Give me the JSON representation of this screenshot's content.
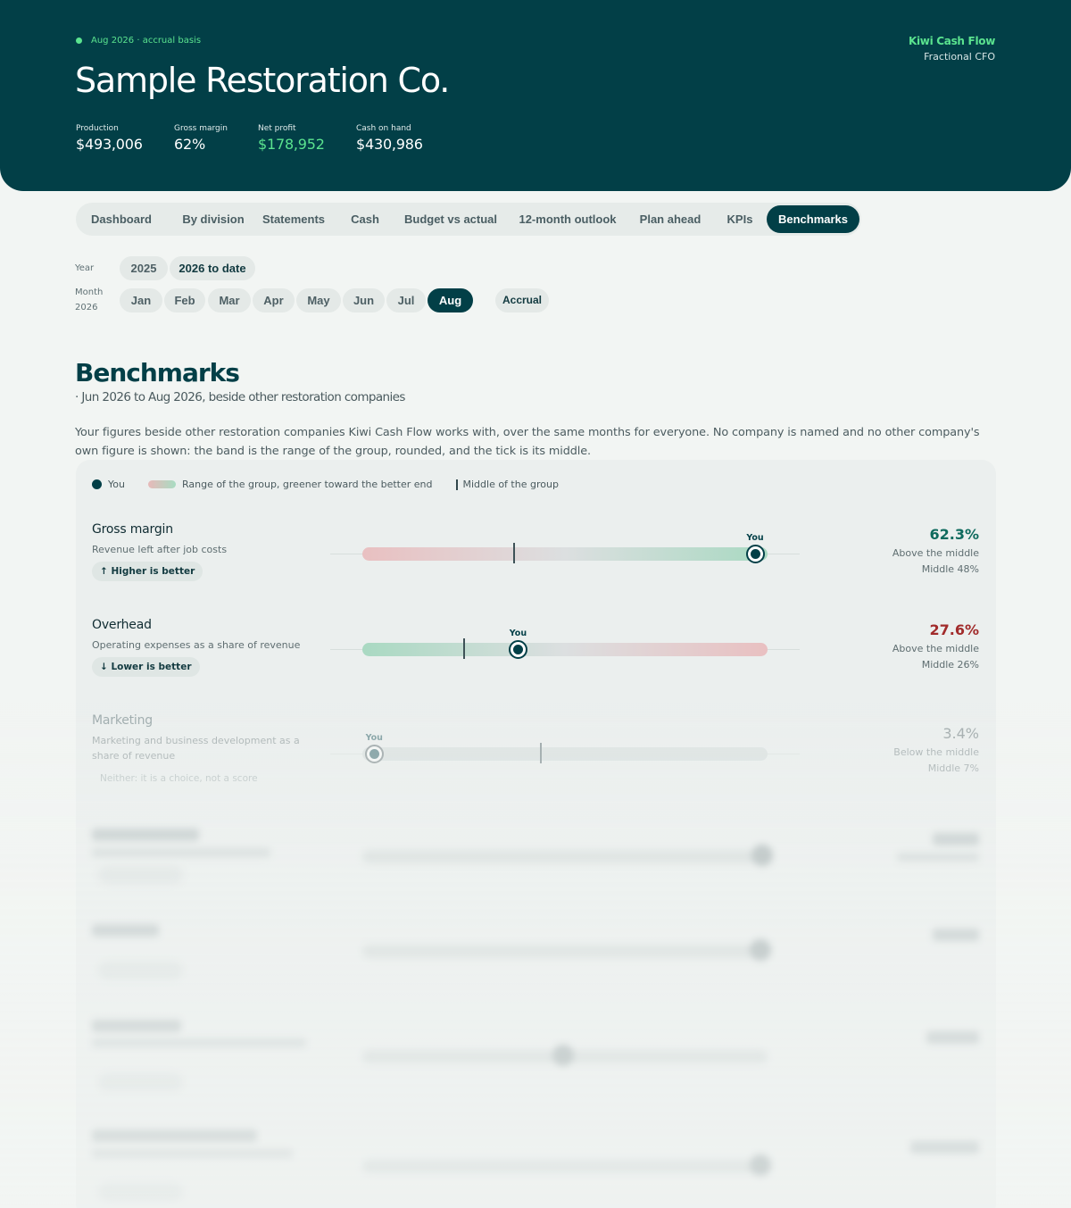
{
  "header": {
    "period": "Aug 2026 · accrual basis",
    "company": "Sample Restoration Co.",
    "brand": "Kiwi Cash Flow",
    "brand_role": "Fractional CFO",
    "stats": [
      {
        "label": "Production",
        "value": "$493,006"
      },
      {
        "label": "Gross margin",
        "value": "62%"
      },
      {
        "label": "Net profit",
        "value": "$178,952"
      },
      {
        "label": "Cash on hand",
        "value": "$430,986"
      }
    ]
  },
  "tabs": [
    "Dashboard",
    "By division",
    "Statements",
    "Cash",
    "Budget vs actual",
    "12-month outlook",
    "Plan ahead",
    "KPIs",
    "Benchmarks"
  ],
  "active_tab": "Benchmarks",
  "filters": {
    "year_label": "Year",
    "years": [
      "2025",
      "2026 to date"
    ],
    "month_label": "Month",
    "month_year": "2026",
    "months": [
      "Jan",
      "Feb",
      "Mar",
      "Apr",
      "May",
      "Jun",
      "Jul",
      "Aug"
    ],
    "selected_month": "Aug",
    "basis": "Accrual"
  },
  "section": {
    "title": "Benchmarks",
    "subtitle": "· Jun 2026 to Aug 2026, beside other restoration companies",
    "description": "Your figures beside other restoration companies Kiwi Cash Flow works with, over the same months for everyone. No company is named and no other company's own figure is shown: the band is the range of the group, rounded, and the tick is its middle."
  },
  "legend": {
    "you": "You",
    "range": "Range of the group, greener toward the better end",
    "middle": "Middle of the group"
  },
  "metrics": [
    {
      "name": "Gross margin",
      "description": "Revenue left after job costs",
      "direction": "↑ Higher is better",
      "value": "62.3%",
      "status": "Above the middle",
      "middle": "Middle 48%",
      "you_label": "You",
      "you_position": 0.97,
      "middle_position": 0.375,
      "value_color": "#0f6b5e"
    },
    {
      "name": "Overhead",
      "description": "Operating expenses as a share of revenue",
      "direction": "↓ Lower is better",
      "value": "27.6%",
      "status": "Above the middle",
      "middle": "Middle 26%",
      "you_label": "You",
      "you_position": 0.385,
      "middle_position": 0.25,
      "value_color": "#a12b2b"
    },
    {
      "name": "Marketing",
      "description": "Marketing and business development as a share of revenue",
      "direction": "Neither: it is a choice, not a score",
      "value": "3.4%",
      "status": "Below the middle",
      "middle": "Middle 7%",
      "you_label": "You",
      "you_position": 0.03,
      "middle_position": 0.44,
      "value_color": "#4a5a5e"
    }
  ],
  "colors": {
    "primary": "#023f47",
    "accent_green": "#5be38f",
    "good": "#0f6b5e",
    "bad": "#a12b2b"
  }
}
